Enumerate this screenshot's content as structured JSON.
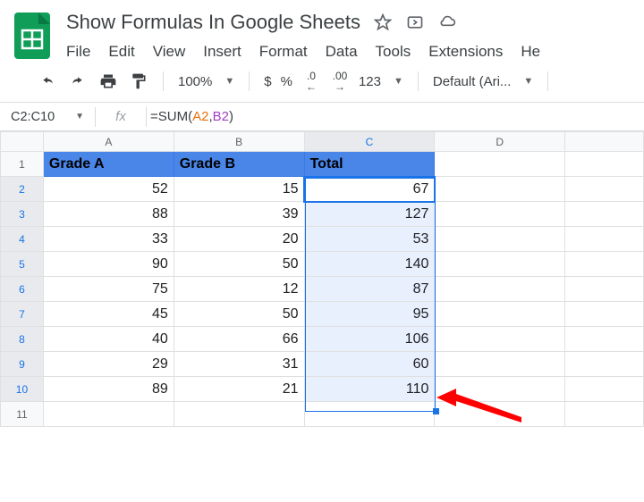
{
  "doc": {
    "title": "Show Formulas In Google Sheets"
  },
  "menus": {
    "file": "File",
    "edit": "Edit",
    "view": "View",
    "insert": "Insert",
    "format": "Format",
    "data": "Data",
    "tools": "Tools",
    "extensions": "Extensions",
    "help": "He"
  },
  "toolbar": {
    "zoom": "100%",
    "currency": "$",
    "percent": "%",
    "dec_dec": ".0",
    "dec_inc": ".00",
    "fmt123": "123",
    "font": "Default (Ari..."
  },
  "fx": {
    "range": "C2:C10",
    "prefix": "=SUM(",
    "ref1": "A2",
    "comma": ",",
    "ref2": "B2",
    "suffix": ")"
  },
  "cols": [
    "A",
    "B",
    "C",
    "D"
  ],
  "rowNums": [
    "1",
    "2",
    "3",
    "4",
    "5",
    "6",
    "7",
    "8",
    "9",
    "10",
    "11"
  ],
  "headers": {
    "a": "Grade A",
    "b": "Grade B",
    "c": "Total"
  },
  "rows": [
    {
      "a": "52",
      "b": "15",
      "c": "67"
    },
    {
      "a": "88",
      "b": "39",
      "c": "127"
    },
    {
      "a": "33",
      "b": "20",
      "c": "53"
    },
    {
      "a": "90",
      "b": "50",
      "c": "140"
    },
    {
      "a": "75",
      "b": "12",
      "c": "87"
    },
    {
      "a": "45",
      "b": "50",
      "c": "95"
    },
    {
      "a": "40",
      "b": "66",
      "c": "106"
    },
    {
      "a": "29",
      "b": "31",
      "c": "60"
    },
    {
      "a": "89",
      "b": "21",
      "c": "110"
    }
  ]
}
